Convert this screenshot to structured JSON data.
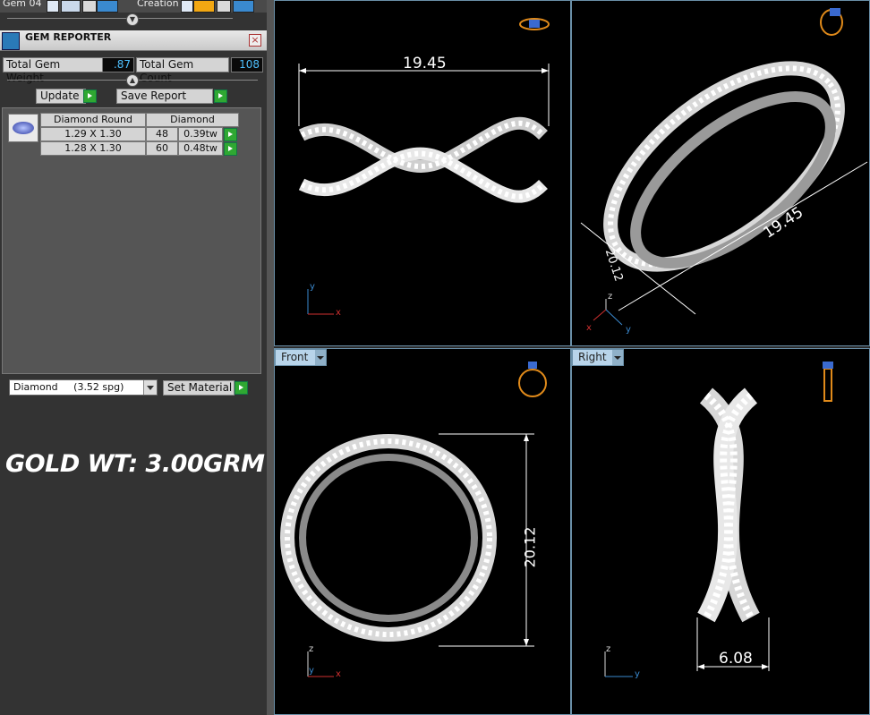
{
  "top_strip": {
    "gem_label": "Gem 04",
    "creation_label": "Creation"
  },
  "gem_reporter": {
    "title": "GEM REPORTER",
    "total_gem_weight_label": "Total Gem Weight",
    "total_gem_weight_value": ".87",
    "total_gem_count_label": "Total Gem Count",
    "total_gem_count_value": "108",
    "update_label": "Update",
    "save_report_label": "Save Report",
    "table": {
      "headers": [
        "Diamond Round",
        "Diamond"
      ],
      "rows": [
        {
          "size": "1.29 X 1.30",
          "count": "48",
          "weight": "0.39tw"
        },
        {
          "size": "1.28 X 1.30",
          "count": "60",
          "weight": "0.48tw"
        }
      ]
    },
    "material_select": "Diamond     (3.52 spg)",
    "set_material_label": "Set Material"
  },
  "overlay_text": "GOLD WT: 3.00GRM",
  "viewports": {
    "top": {
      "dimension": "19.45",
      "axes": {
        "x": "x",
        "y": "y"
      }
    },
    "perspective": {
      "dim_length": "19.45",
      "dim_height": "20.12",
      "axes": {
        "x": "x",
        "y": "y",
        "z": "z"
      }
    },
    "front": {
      "tab": "Front",
      "dimension": "20.12",
      "axes": {
        "x": "x",
        "y": "y",
        "z": "z"
      }
    },
    "right": {
      "tab": "Right",
      "dimension": "6.08",
      "axes": {
        "y": "y",
        "z": "z"
      }
    }
  },
  "colors": {
    "panel_bg": "#333333",
    "viewport_bg": "#000000",
    "viewport_border": "#6a8fa8",
    "accent_value": "#4ec0ff",
    "go_green": "#2fa832",
    "axis_x": "#d03030",
    "axis_y": "#3a8ad0",
    "axis_z": "#d8d8d8"
  },
  "icons": [
    "gem-reporter-icon",
    "close-icon",
    "play-arrow-icon",
    "dropdown-arrow-icon",
    "gem-thumbnail-icon",
    "ring-view-icon",
    "axis-gizmo-icon"
  ]
}
